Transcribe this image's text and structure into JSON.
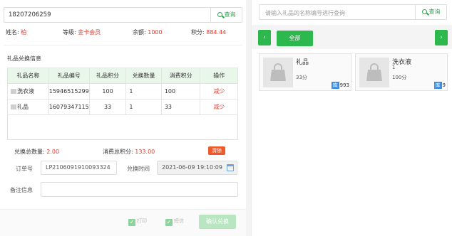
{
  "member": {
    "search_value": "18207206259",
    "search_btn": "查询",
    "name_label": "姓名:",
    "name": "柏",
    "level_label": "等级:",
    "level": "金卡会员",
    "balance_label": "余额:",
    "balance": "1000",
    "points_label": "积分:",
    "points": "884.44"
  },
  "section_title": "礼品兑换信息",
  "table": {
    "headers": [
      "礼品名称",
      "礼品编号",
      "礼品积分",
      "兑换数量",
      "消费积分",
      "操作"
    ],
    "rows": [
      {
        "name": "洗衣液",
        "code": "15946515299",
        "points": "100",
        "qty": "1",
        "cost": "100",
        "op": "减少"
      },
      {
        "name": "礼品",
        "code": "16079347115",
        "points": "33",
        "qty": "1",
        "cost": "33",
        "op": "减少"
      }
    ]
  },
  "summary": {
    "qty_label": "兑换总数量:",
    "qty": "2.00",
    "points_label": "消费总积分:",
    "points": "133.00",
    "clear_btn": "清除"
  },
  "order": {
    "label": "订单号",
    "value": "LP2106091910093324",
    "time_label": "兑换时间",
    "time_value": "2021-06-09 19:10:09",
    "remark_label": "备注信息",
    "remark_value": ""
  },
  "footer": {
    "check1": "打印",
    "check2": "短信",
    "pay_btn": "确认兑换"
  },
  "right": {
    "search_placeholder": "请输入礼品的名称编号进行查询",
    "search_btn": "查询",
    "prev": "‹",
    "next": "›",
    "all_btn": "全部",
    "cards": [
      {
        "name": "礼品",
        "sub": "",
        "points": "33分",
        "stock_label": "库",
        "stock": "993"
      },
      {
        "name": "洗衣液",
        "sub": "1",
        "points": "100分",
        "stock_label": "库",
        "stock": "9"
      }
    ]
  },
  "colors": {
    "accent": "#2db84d",
    "red": "#e03a2f",
    "clear": "#f05a2a",
    "stock": "#3b8ee6"
  }
}
